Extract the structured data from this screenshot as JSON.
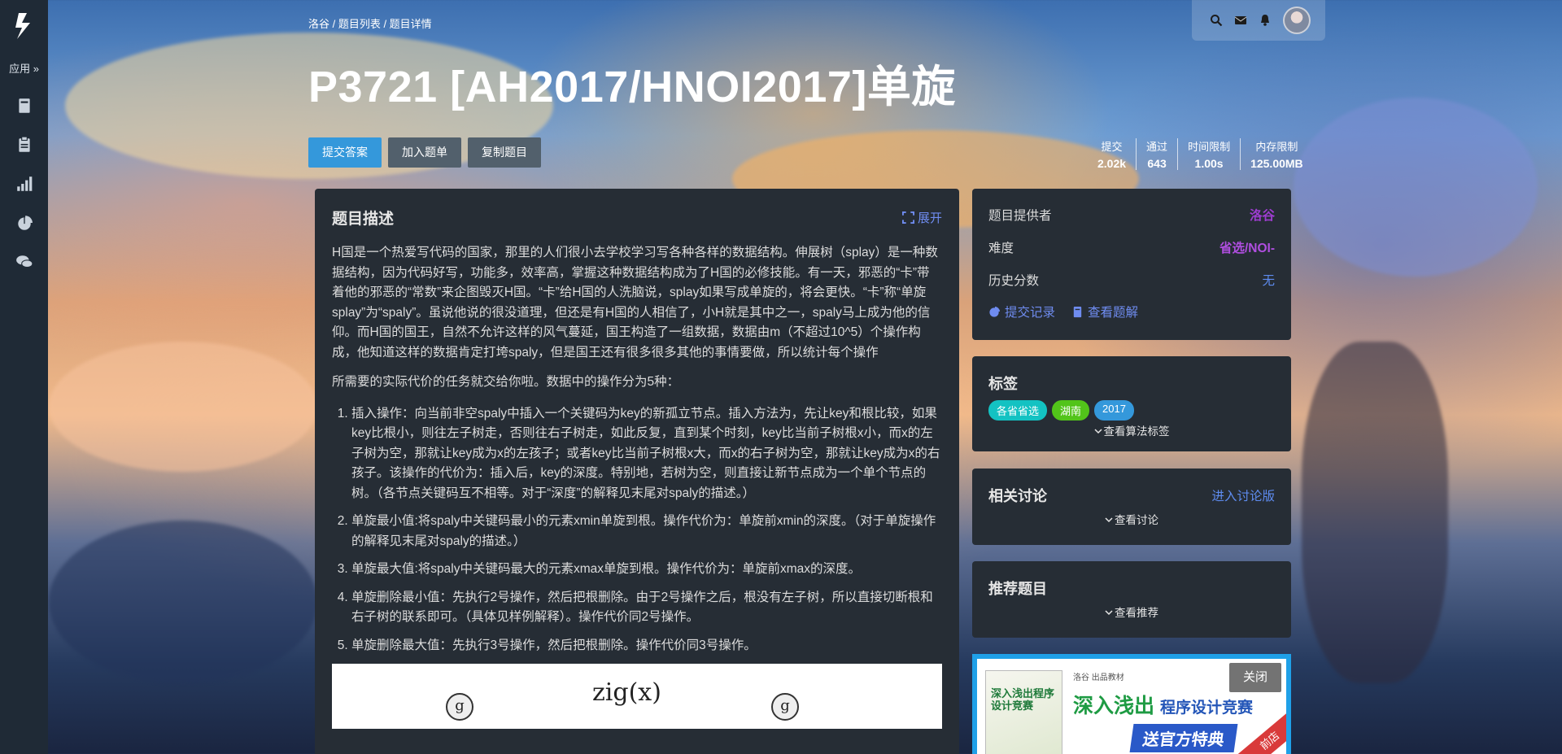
{
  "sidebar": {
    "logo": "luogu-logo",
    "apps_label": "应用",
    "items": [
      {
        "icon": "book-icon"
      },
      {
        "icon": "clipboard-icon"
      },
      {
        "icon": "bar-chart-icon"
      },
      {
        "icon": "pie-chart-icon"
      },
      {
        "icon": "comments-icon"
      }
    ]
  },
  "topbar": {
    "icons": [
      "search-icon",
      "mail-icon",
      "bell-icon",
      "avatar"
    ]
  },
  "breadcrumb": "洛谷 / 题目列表 / 题目详情",
  "title": "P3721 [AH2017/HNOI2017]单旋",
  "buttons": {
    "submit": "提交答案",
    "add_list": "加入题单",
    "copy": "复制题目"
  },
  "stats": [
    {
      "label": "提交",
      "value": "2.02k"
    },
    {
      "label": "通过",
      "value": "643"
    },
    {
      "label": "时间限制",
      "value": "1.00s"
    },
    {
      "label": "内存限制",
      "value": "125.00MB"
    }
  ],
  "description": {
    "heading": "题目描述",
    "expand": "展开",
    "para1": "H国是一个热爱写代码的国家，那里的人们很小去学校学习写各种各样的数据结构。伸展树（splay）是一种数据结构，因为代码好写，功能多，效率高，掌握这种数据结构成为了H国的必修技能。有一天，邪恶的“卡”带着他的邪恶的“常数”来企图毁灭H国。“卡”给H国的人洗脑说，splay如果写成单旋的，将会更快。“卡”称“单旋splay”为“spaly”。虽说他说的很没道理，但还是有H国的人相信了，小H就是其中之一，spaly马上成为他的信仰。而H国的国王，自然不允许这样的风气蔓延，国王构造了一组数据，数据由m（不超过10^5）个操作构成，他知道这样的数据肯定打垮spaly，但是国王还有很多很多其他的事情要做，所以统计每个操作",
    "para2": "所需要的实际代价的任务就交给你啦。数据中的操作分为5种：",
    "ops": [
      "插入操作：向当前非空spaly中插入一个关键码为key的新孤立节点。插入方法为，先让key和根比较，如果key比根小，则往左子树走，否则往右子树走，如此反复，直到某个时刻，key比当前子树根x小，而x的左子树为空，那就让key成为x的左孩子；或者key比当前子树根x大，而x的右子树为空，那就让key成为x的右孩子。该操作的代价为：插入后，key的深度。特别地，若树为空，则直接让新节点成为一个单个节点的树。（各节点关键码互不相等。对于“深度”的解释见末尾对spaly的描述。）",
      "单旋最小值:将spaly中关键码最小的元素xmin单旋到根。操作代价为：单旋前xmin的深度。（对于单旋操作的解释见末尾对spaly的描述。）",
      "单旋最大值:将spaly中关键码最大的元素xmax单旋到根。操作代价为：单旋前xmax的深度。",
      "单旋删除最小值：先执行2号操作，然后把根删除。由于2号操作之后，根没有左子树，所以直接切断根和右子树的联系即可。（具体见样例解释）。操作代价同2号操作。",
      "单旋删除最大值：先执行3号操作，然后把根删除。操作代价同3号操作。"
    ],
    "figure_label": "zig(x)",
    "figure_node": "g"
  },
  "info": {
    "provider_label": "题目提供者",
    "provider_value": "洛谷",
    "difficulty_label": "难度",
    "difficulty_value": "省选/NOI-",
    "history_label": "历史分数",
    "history_value": "无",
    "records_link": "提交记录",
    "solutions_link": "查看题解"
  },
  "tags": {
    "heading": "标签",
    "items": [
      {
        "label": "各省省选",
        "color": "#13c2c2"
      },
      {
        "label": "湖南",
        "color": "#52c41a"
      },
      {
        "label": "2017",
        "color": "#3498db"
      }
    ],
    "more": "查看算法标签"
  },
  "discussion": {
    "heading": "相关讨论",
    "enter": "进入讨论版",
    "more": "查看讨论"
  },
  "recommend": {
    "heading": "推荐题目",
    "more": "查看推荐"
  },
  "ad": {
    "brand": "洛谷 出品教材",
    "headline_main": "深入浅出",
    "headline_sub": "程序设计竞赛",
    "ribbon": "送官方特典",
    "book_title": "深入浅出程序设计竞赛",
    "corner": "前店",
    "close": "关闭"
  },
  "colors": {
    "primary": "#3498db",
    "card_bg": "#262d35",
    "sidebar_bg": "#1f2a36",
    "link": "#6f8cf0",
    "provider": "#9d3dcf",
    "difficulty": "#b04ee0"
  }
}
